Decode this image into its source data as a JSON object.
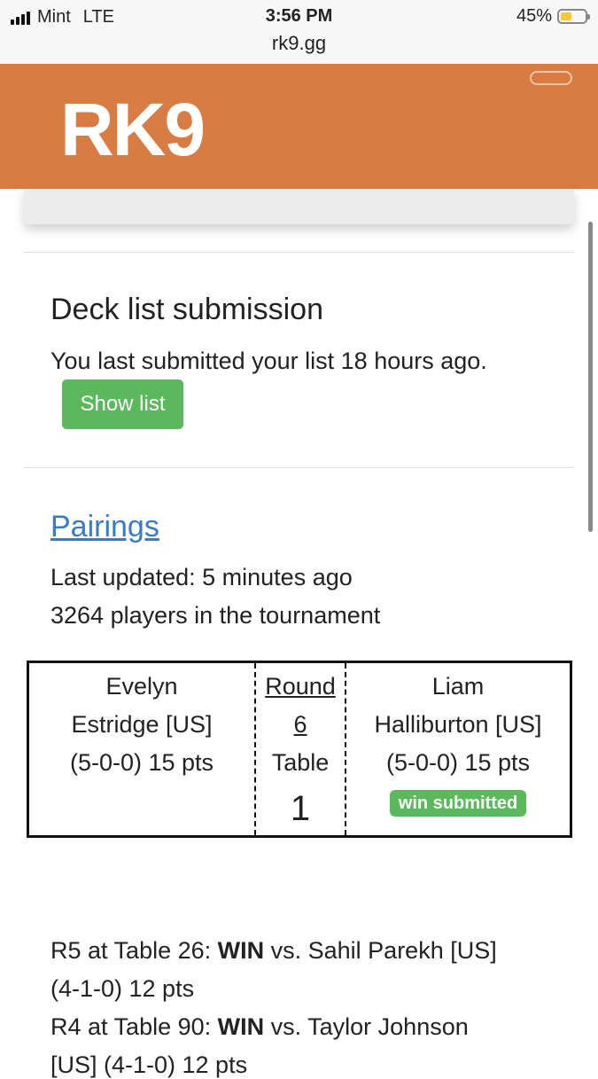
{
  "status_bar": {
    "carrier": "Mint",
    "network": "LTE",
    "time": "3:56 PM",
    "battery": "45%",
    "battery_level": 0.45,
    "url": "rk9.gg"
  },
  "header": {
    "logo": "RK9",
    "brand_color": "#d97c44"
  },
  "deck": {
    "title": "Deck list submission",
    "text": "You last submitted your list 18 hours ago.",
    "button": "Show list"
  },
  "pairings": {
    "title": "Pairings",
    "last_updated": "Last updated: 5 minutes ago",
    "players": "3264 players in the tournament",
    "player1": {
      "name_line1": "Evelyn",
      "name_line2": "Estridge [US]",
      "record": "(5-0-0) 15 pts"
    },
    "round_label": "Round",
    "round_number": "6",
    "table_label": "Table",
    "table_number": "1",
    "player2": {
      "name_line1": "Liam",
      "name_line2": "Halliburton [US]",
      "record": "(5-0-0) 15 pts",
      "badge": "win submitted"
    }
  },
  "history": [
    {
      "prefix": "R5 at Table 26: ",
      "result": "WIN",
      "rest": " vs. Sahil Parekh [US]",
      "line2": "(4-1-0) 12 pts"
    },
    {
      "prefix": "R4 at Table 90: ",
      "result": "WIN",
      "rest": " vs. Taylor Johnson",
      "line2": "[US] (4-1-0) 12 pts"
    }
  ],
  "colors": {
    "success": "#5cb85c",
    "link": "#3a7bc8"
  }
}
